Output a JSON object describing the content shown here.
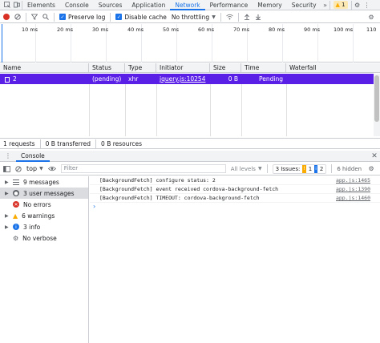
{
  "tabs": [
    {
      "label": "Elements"
    },
    {
      "label": "Console"
    },
    {
      "label": "Sources"
    },
    {
      "label": "Application"
    },
    {
      "label": "Network"
    },
    {
      "label": "Performance"
    },
    {
      "label": "Memory"
    },
    {
      "label": "Security"
    }
  ],
  "warn_badge": "1",
  "network_toolbar": {
    "preserve_log": "Preserve log",
    "disable_cache": "Disable cache",
    "throttling": "No throttling"
  },
  "timeline": {
    "ticks": [
      "10 ms",
      "20 ms",
      "30 ms",
      "40 ms",
      "50 ms",
      "60 ms",
      "70 ms",
      "80 ms",
      "90 ms",
      "100 ms",
      "110"
    ]
  },
  "table": {
    "headers": [
      "Name",
      "Status",
      "Type",
      "Initiator",
      "Size",
      "Time",
      "Waterfall"
    ],
    "rows": [
      {
        "name": "2",
        "status": "(pending)",
        "type": "xhr",
        "initiator": "jquery.js:10254",
        "size": "0 B",
        "time": "Pending"
      }
    ]
  },
  "status_bar": {
    "requests": "1 requests",
    "transferred": "0 B transferred",
    "resources": "0 B resources"
  },
  "drawer": {
    "tab": "Console"
  },
  "console_toolbar": {
    "context": "top",
    "filter_placeholder": "Filter",
    "levels": "All levels",
    "issues_label": "3 Issues:",
    "issues_warn": "1",
    "issues_info": "2",
    "hidden": "6 hidden"
  },
  "sidebar": [
    {
      "label": "9 messages"
    },
    {
      "label": "3 user messages"
    },
    {
      "label": "No errors"
    },
    {
      "label": "6 warnings"
    },
    {
      "label": "3 info"
    },
    {
      "label": "No verbose"
    }
  ],
  "console_lines": [
    {
      "text": "[BackgroundFetch] configure status:  2",
      "src": "app.js:1465"
    },
    {
      "text": "[BackgroundFetch] event received cordova-background-fetch",
      "src": "app.js:1390"
    },
    {
      "text": "[BackgroundFetch] TIMEOUT:  cordova-background-fetch",
      "src": "app.js:1460"
    }
  ],
  "colors": {
    "accent": "#1a73e8",
    "selected_row": "#5a1fe6",
    "error": "#d93025",
    "warning": "#f9ab00"
  }
}
